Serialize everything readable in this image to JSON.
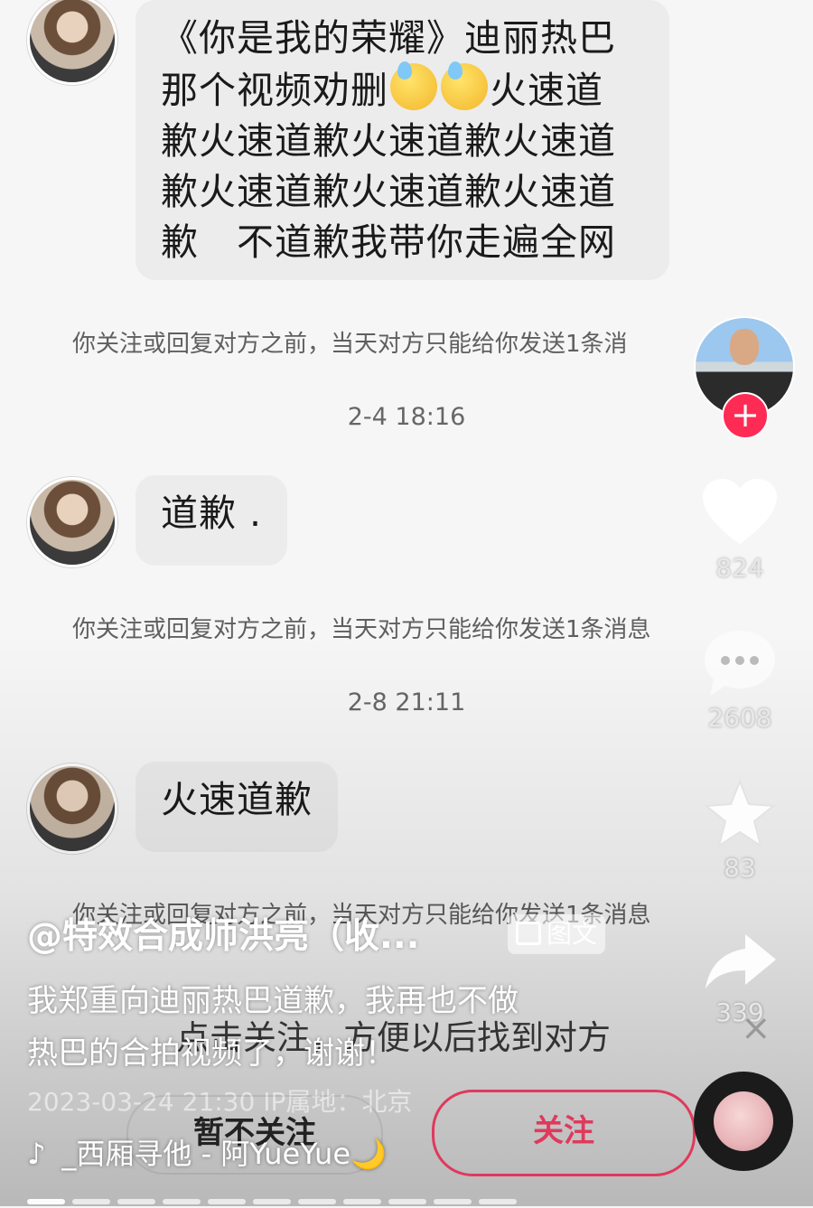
{
  "messages": [
    {
      "text_lines": [
        "《你是我的荣耀》迪丽热巴",
        "那个视频劝删",
        "火速道",
        "歉火速道歉火速道歉火速道",
        "歉火速道歉火速道歉火速道",
        "歉　不道歉我带你走遍全网"
      ]
    },
    {
      "text": "道歉 ."
    },
    {
      "text": "火速道歉"
    }
  ],
  "notices": [
    "你关注或回复对方之前，当天对方只能给你发送1条消",
    "你关注或回复对方之前，当天对方只能给你发送1条消息",
    "你关注或回复对方之前，当天对方只能给你发送1条消息"
  ],
  "timestamps": [
    "2-4 18:16",
    "2-8 21:11"
  ],
  "side": {
    "likes": "824",
    "comments": "2608",
    "favorites": "83",
    "shares": "339",
    "plus": "+"
  },
  "post": {
    "author": "@特效合成师洪亮（收...",
    "tag": "图文",
    "caption_line1": "我郑重向迪丽热巴道歉，我再也不做",
    "caption_line2": "热巴的合拍视频了，谢谢！",
    "meta": "2023-03-24 21:30  IP属地：北京",
    "music": "_西厢寻他 - 阿YueYue🌙"
  },
  "follow_prompt": {
    "text": "点击关注，方便以后找到对方",
    "close": "×",
    "decline_label": "暂不关注",
    "follow_label": "关注"
  },
  "colors": {
    "accent": "#fe2c55",
    "bubble": "#ececec"
  },
  "icons": [
    "heart-icon",
    "comment-icon",
    "star-icon",
    "share-icon",
    "tiktok-note-icon",
    "plus-icon",
    "close-icon"
  ]
}
